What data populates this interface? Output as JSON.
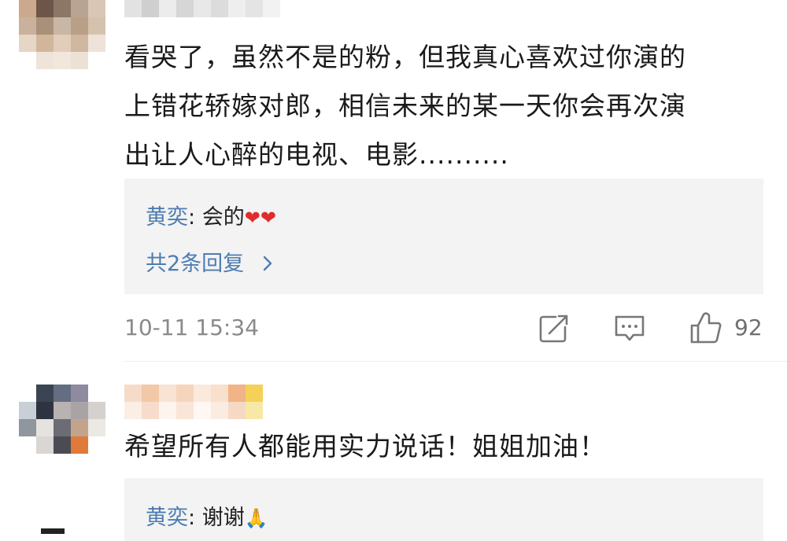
{
  "comments": [
    {
      "text_lines": [
        "看哭了，虽然不是的粉，但我真心喜欢过你演的",
        "上错花轿嫁对郎，相信未来的某一天你会再次演",
        "出让人心醉的电视、电影.........."
      ],
      "reply": {
        "author": "黄奕",
        "separator": ":",
        "text": "会的",
        "emoji": "❤❤",
        "more_label": "共2条回复",
        "more_icon": "chevron-right-icon"
      },
      "time": "10-11 15:34",
      "likes": "92"
    },
    {
      "text_lines": [
        "希望所有人都能用实力说话！姐姐加油！"
      ],
      "reply": {
        "author": "黄奕",
        "separator": ":",
        "text": "谢谢",
        "emoji": "🙏"
      }
    }
  ],
  "icons": {
    "share": "share-icon",
    "comment": "comment-icon",
    "like": "thumbs-up-icon"
  },
  "colors": {
    "author_blue": "#4d7cb1",
    "reply_bg": "#f3f3f3",
    "meta_gray": "#8a8a8a",
    "heart_red": "#e22b2b"
  }
}
